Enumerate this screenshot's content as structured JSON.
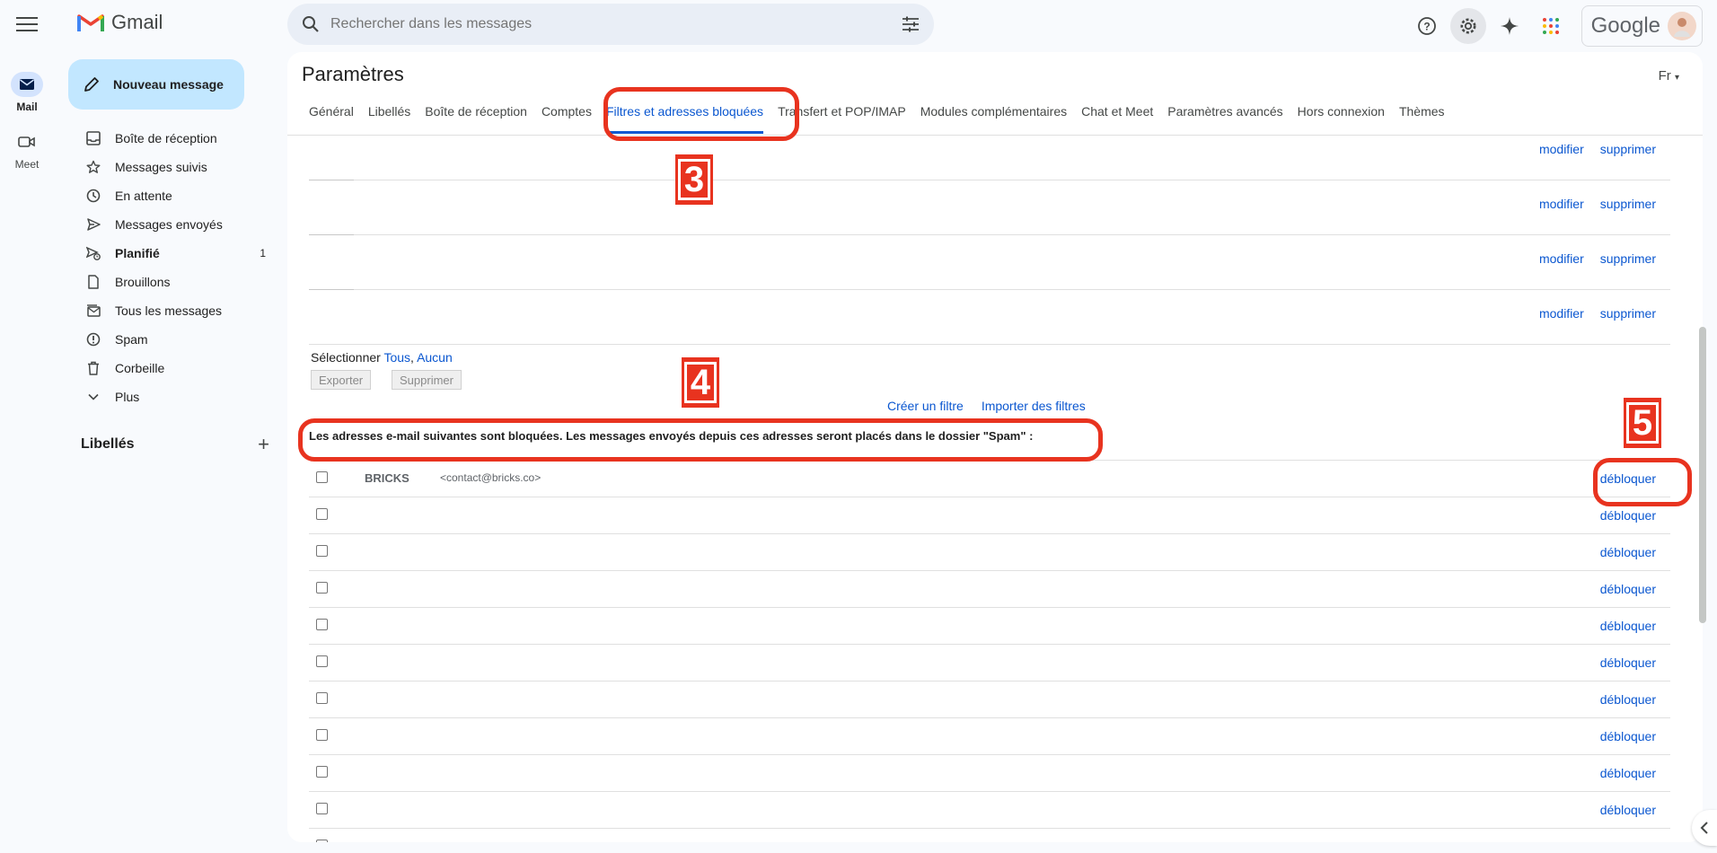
{
  "app": {
    "name": "Gmail"
  },
  "rail": {
    "mail_label": "Mail",
    "meet_label": "Meet"
  },
  "search": {
    "placeholder": "Rechercher dans les messages"
  },
  "account": {
    "google_word": "Google"
  },
  "compose": {
    "label": "Nouveau message"
  },
  "nav": {
    "items": [
      {
        "label": "Boîte de réception",
        "icon": "inbox-icon"
      },
      {
        "label": "Messages suivis",
        "icon": "star-icon"
      },
      {
        "label": "En attente",
        "icon": "clock-icon"
      },
      {
        "label": "Messages envoyés",
        "icon": "send-icon"
      },
      {
        "label": "Planifié",
        "icon": "scheduled-icon",
        "count": "1"
      },
      {
        "label": "Brouillons",
        "icon": "draft-icon"
      },
      {
        "label": "Tous les messages",
        "icon": "all-mail-icon"
      },
      {
        "label": "Spam",
        "icon": "spam-icon"
      },
      {
        "label": "Corbeille",
        "icon": "trash-icon"
      },
      {
        "label": "Plus",
        "icon": "chevron-down-icon"
      }
    ],
    "labels_heading": "Libellés"
  },
  "settings": {
    "title": "Paramètres",
    "lang": "Fr",
    "tabs": [
      {
        "label": "Général"
      },
      {
        "label": "Libellés"
      },
      {
        "label": "Boîte de réception"
      },
      {
        "label": "Comptes"
      },
      {
        "label": "Filtres et adresses bloquées",
        "active": true
      },
      {
        "label": "Transfert et POP/IMAP"
      },
      {
        "label": "Modules complémentaires"
      },
      {
        "label": "Chat et Meet"
      },
      {
        "label": "Paramètres avancés"
      },
      {
        "label": "Hors connexion"
      },
      {
        "label": "Thèmes"
      }
    ],
    "filters": {
      "edit_label": "modifier",
      "delete_label": "supprimer",
      "select_label": "Sélectionner",
      "select_all": "Tous",
      "select_none": "Aucun",
      "export_label": "Exporter",
      "delete_button_label": "Supprimer",
      "create_filter": "Créer un filtre",
      "import_filters": "Importer des filtres"
    },
    "blocked": {
      "heading": "Les adresses e-mail suivantes sont bloquées. Les messages envoyés depuis ces adresses seront placés dans le dossier \"Spam\" :",
      "unblock_label": "débloquer",
      "first_name": "BRICKS",
      "first_email": "<contact@bricks.co>"
    }
  },
  "annotations": {
    "n3": "3",
    "n4": "4",
    "n5": "5",
    "color": "#e8331f"
  },
  "colors": {
    "accent": "#0b57d0",
    "compose_bg": "#c2e7ff",
    "surface": "#f8fafd"
  }
}
